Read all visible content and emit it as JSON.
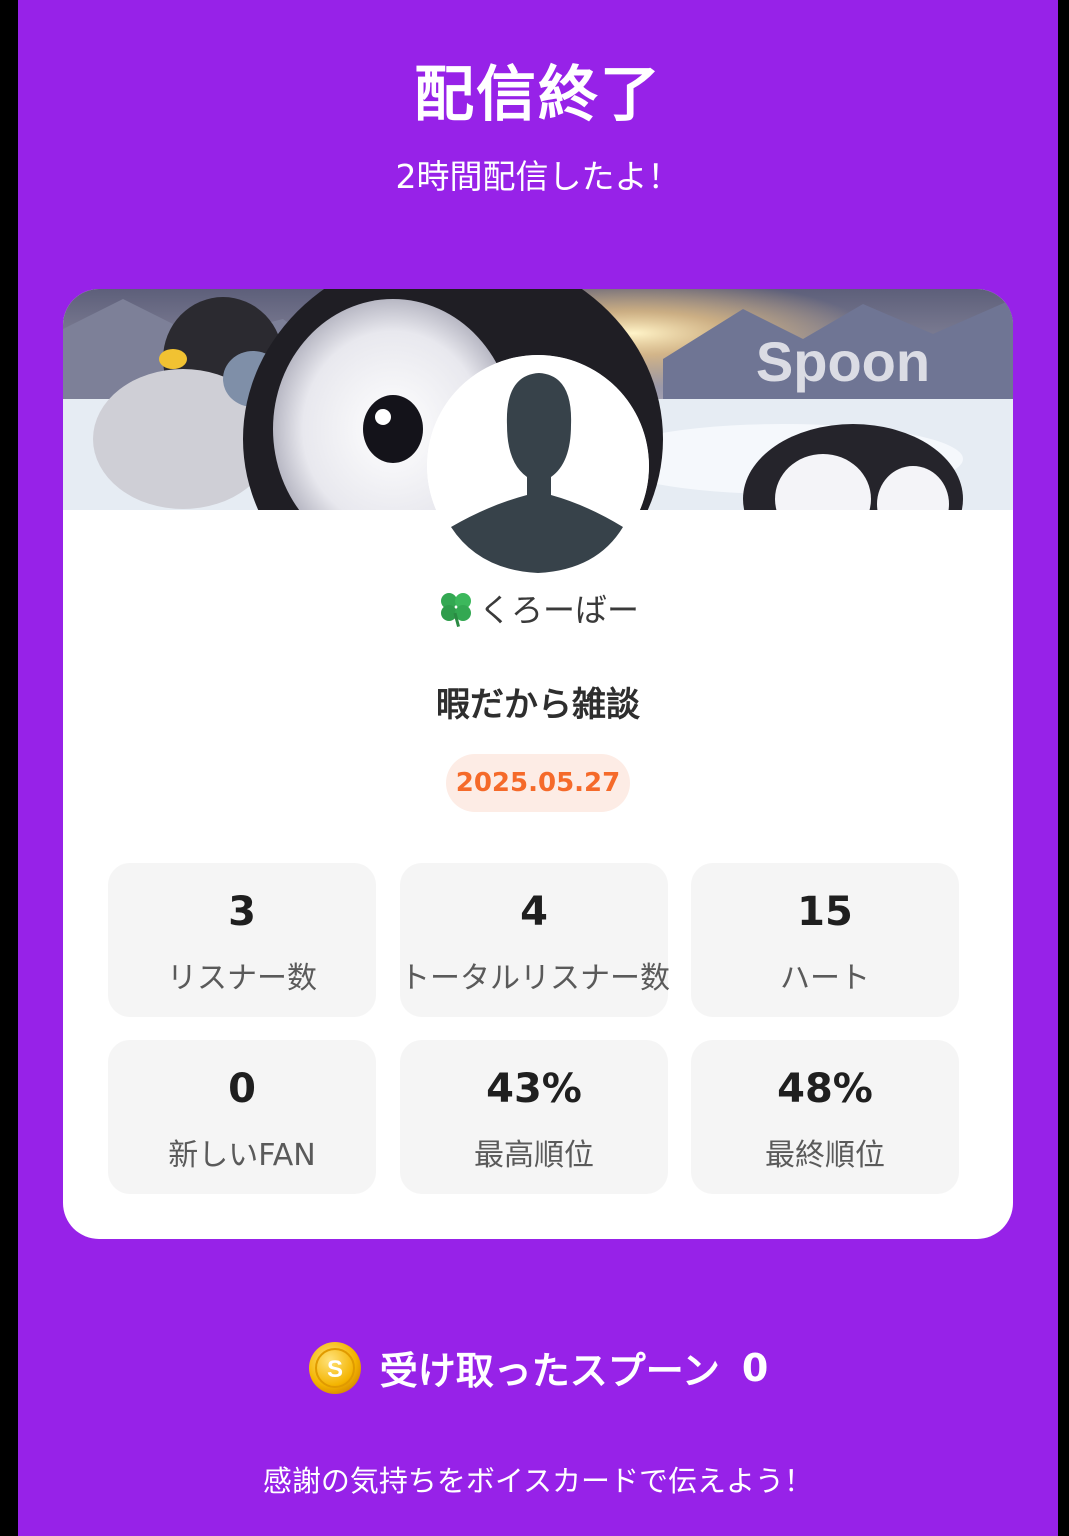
{
  "header": {
    "title": "配信終了",
    "subtitle": "2時間配信したよ！"
  },
  "card": {
    "banner_watermark": "Spoon",
    "username": "くろーばー",
    "username_emoji": "clover-icon",
    "stream_title": "暇だから雑談",
    "date": "2025.05.27"
  },
  "stats": [
    {
      "value": "3",
      "label": "リスナー数"
    },
    {
      "value": "4",
      "label": "トータルリスナー数"
    },
    {
      "value": "15",
      "label": "ハート"
    },
    {
      "value": "0",
      "label": "新しいFAN"
    },
    {
      "value": "43%",
      "label": "最高順位"
    },
    {
      "value": "48%",
      "label": "最終順位"
    }
  ],
  "spoons": {
    "label": "受け取ったスプーン",
    "count": "0",
    "coin_icon": "spoon-coin-icon"
  },
  "footer": {
    "message": "感謝の気持ちをボイスカードで伝えよう！"
  },
  "colors": {
    "background": "#9722e8",
    "card": "#ffffff",
    "stat_bg": "#f5f5f5",
    "date_text": "#f56a2a",
    "date_bg": "#fdece5"
  }
}
